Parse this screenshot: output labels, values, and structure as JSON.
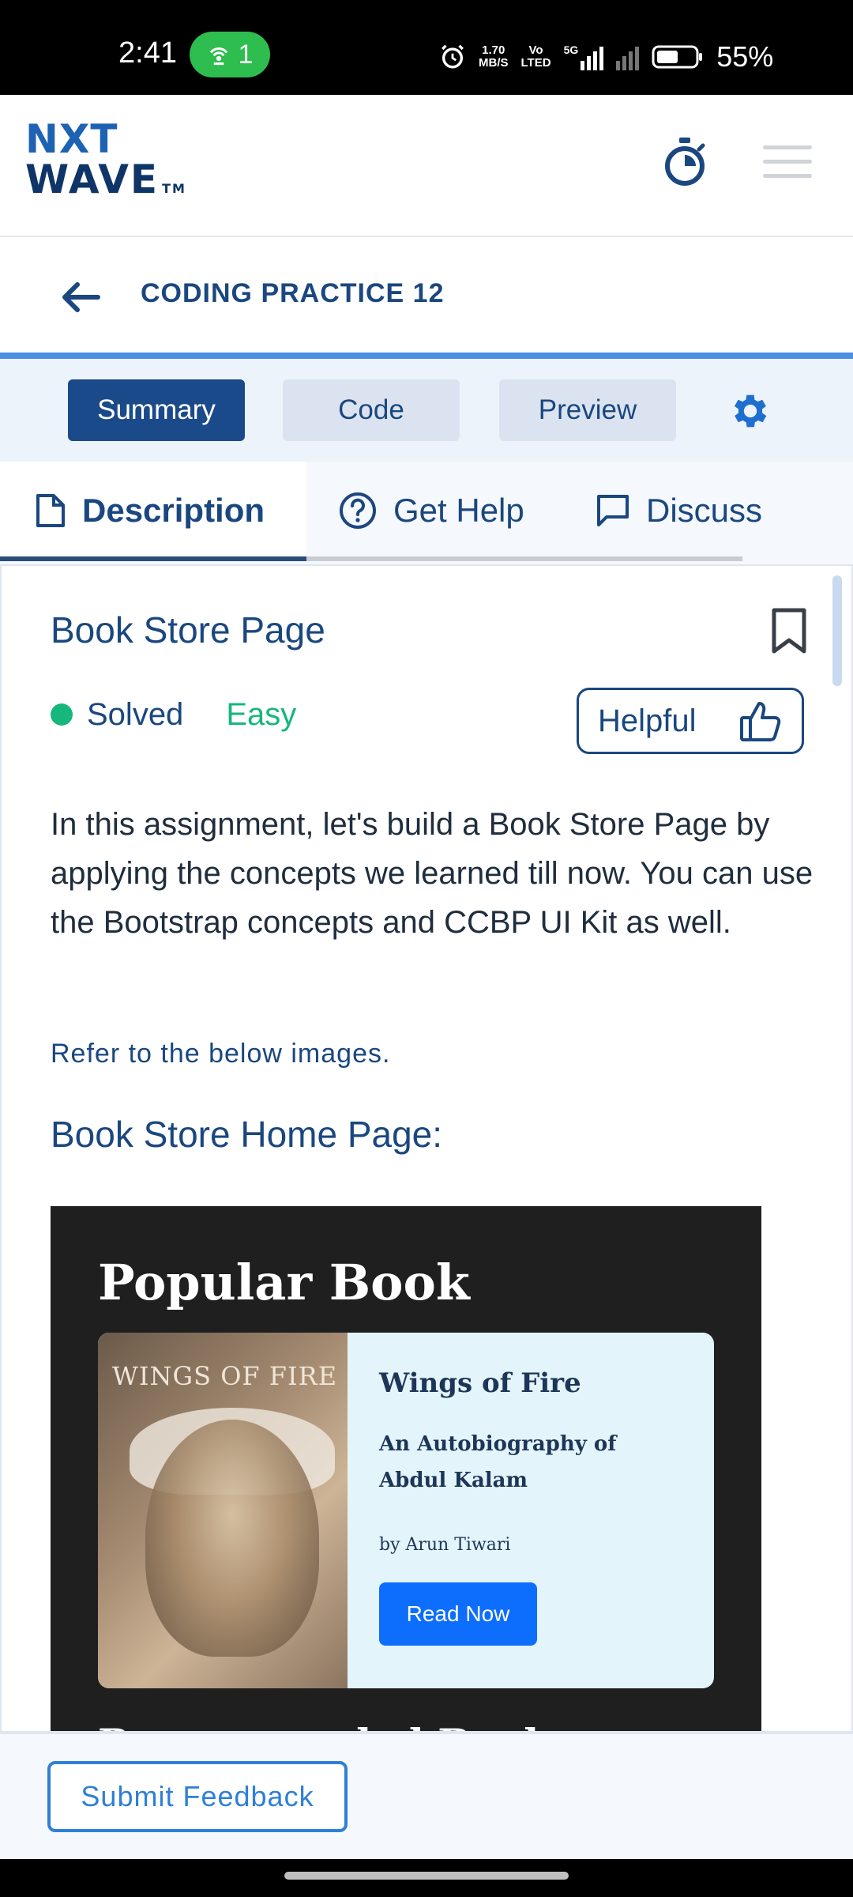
{
  "status_bar": {
    "time": "2:41",
    "hotspot_count": "1",
    "net_speed_top": "1.70",
    "net_speed_bottom": "MB/S",
    "volte_top": "Vo",
    "volte_bottom": "LTED",
    "network": "5G",
    "battery": "55%"
  },
  "header": {
    "logo_line1": "NXT",
    "logo_line2": "WAVE",
    "logo_tm": "TM"
  },
  "titlebar": {
    "title": "CODING PRACTICE 12"
  },
  "modes": {
    "summary": "Summary",
    "code": "Code",
    "preview": "Preview"
  },
  "tabs": {
    "description": "Description",
    "get_help": "Get Help",
    "discuss": "Discuss"
  },
  "question": {
    "title": "Book Store Page",
    "status": "Solved",
    "difficulty": "Easy",
    "helpful_label": "Helpful",
    "description": "In this assignment, let's build a Book Store Page by applying the concepts we learned till now. You can use the Bootstrap concepts and CCBP UI Kit as well.",
    "refer_text": "Refer to the below images.",
    "section_heading": "Book Store Home Page:"
  },
  "preview_image": {
    "heading": "Popular Book",
    "cover_title": "WINGS OF FIRE",
    "book_title": "Wings of Fire",
    "book_subtitle": "An Autobiography of Abdul Kalam",
    "author": "by Arun Tiwari",
    "button": "Read Now",
    "next_heading": "Recommended Books"
  },
  "footer": {
    "feedback_button": "Submit Feedback"
  },
  "colors": {
    "primary": "#1a477f",
    "active_mode": "#1b4a8a",
    "accent_blue": "#4a90e2",
    "success": "#17b67c",
    "feedback": "#2f7fd6"
  }
}
